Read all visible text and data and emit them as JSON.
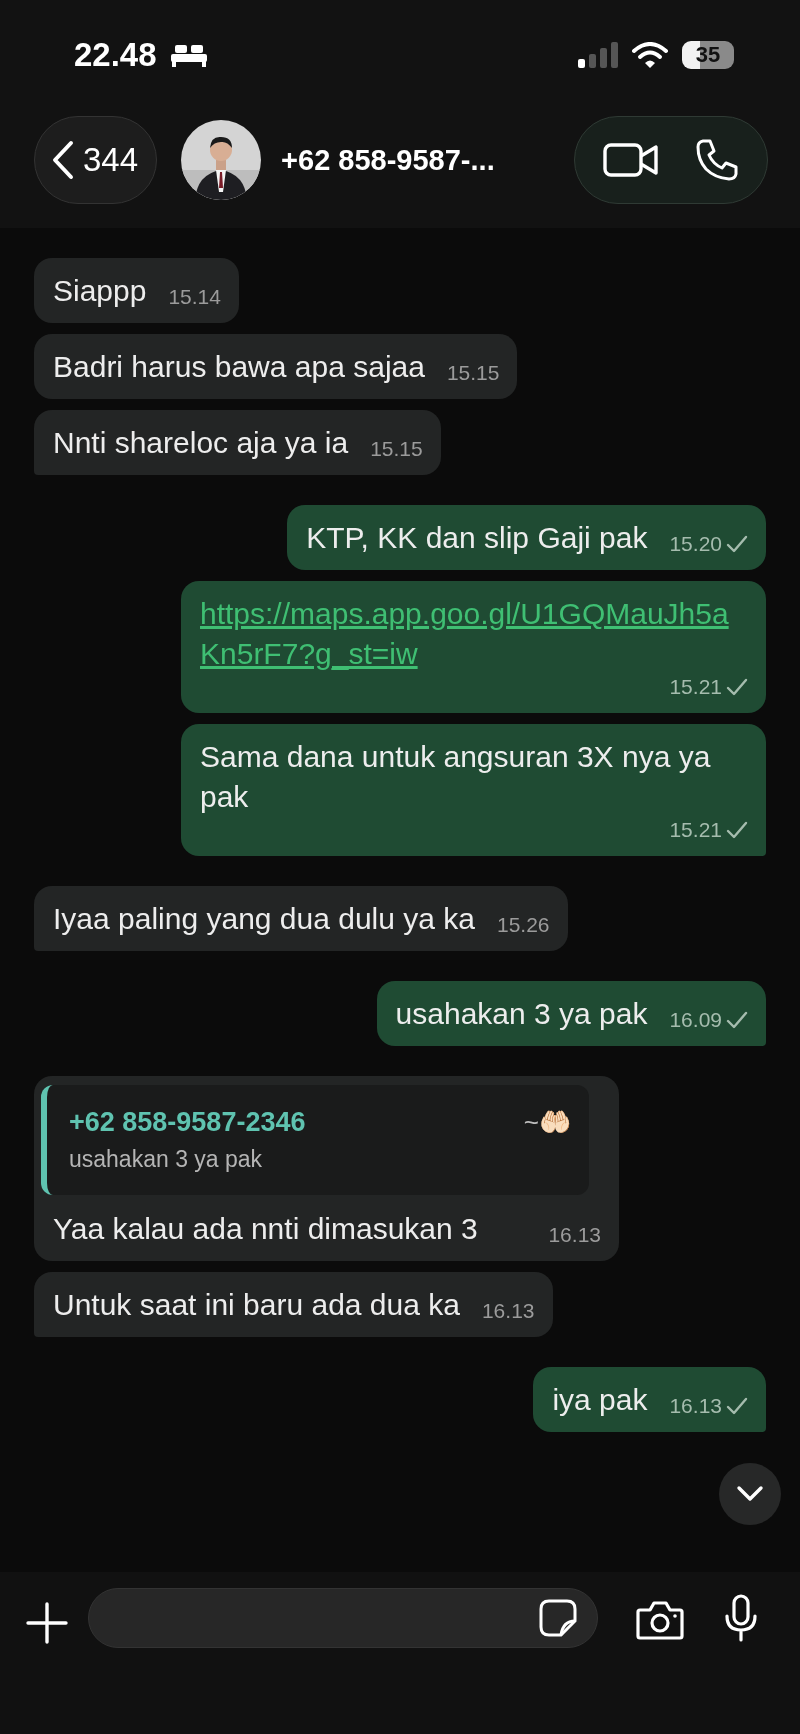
{
  "status_bar": {
    "time": "22.48",
    "battery": "35"
  },
  "header": {
    "back_count": "344",
    "contact_name": "+62 858-9587-..."
  },
  "messages": [
    {
      "kind": "in",
      "text": "Siappp",
      "time": "15.14",
      "tail": false
    },
    {
      "kind": "in",
      "text": "Badri harus bawa apa sajaa",
      "time": "15.15",
      "tail": false
    },
    {
      "kind": "in",
      "text": "Nnti shareloc aja ya ia",
      "time": "15.15",
      "tail": true
    },
    {
      "kind": "out",
      "text": "KTP, KK dan slip Gaji pak",
      "time": "15.20",
      "tail": false,
      "sent": true,
      "link": false
    },
    {
      "kind": "out",
      "text": "https://maps.app.goo.gl/U1GQMauJh5aKn5rF7?g_st=iw",
      "time": "15.21",
      "tail": false,
      "sent": true,
      "link": true
    },
    {
      "kind": "out",
      "text": "Sama dana untuk angsuran 3X nya ya pak",
      "time": "15.21",
      "tail": true,
      "sent": true,
      "link": false
    },
    {
      "kind": "in",
      "text": "Iyaa paling yang dua dulu ya ka",
      "time": "15.26",
      "tail": true
    },
    {
      "kind": "out",
      "text": "usahakan 3 ya pak",
      "time": "16.09",
      "tail": true,
      "sent": true,
      "link": false
    },
    {
      "kind": "in",
      "text": "Yaa kalau ada nnti dimasukan 3",
      "time": "16.13",
      "tail": false,
      "quote": {
        "author": "+62 858-9587-2346",
        "author_suffix": "~🤲🏻",
        "text": "usahakan 3 ya pak"
      }
    },
    {
      "kind": "in",
      "text": "Untuk saat ini baru ada dua ka",
      "time": "16.13",
      "tail": true
    },
    {
      "kind": "out",
      "text": "iya pak",
      "time": "16.13",
      "tail": true,
      "sent": true,
      "link": false
    }
  ]
}
